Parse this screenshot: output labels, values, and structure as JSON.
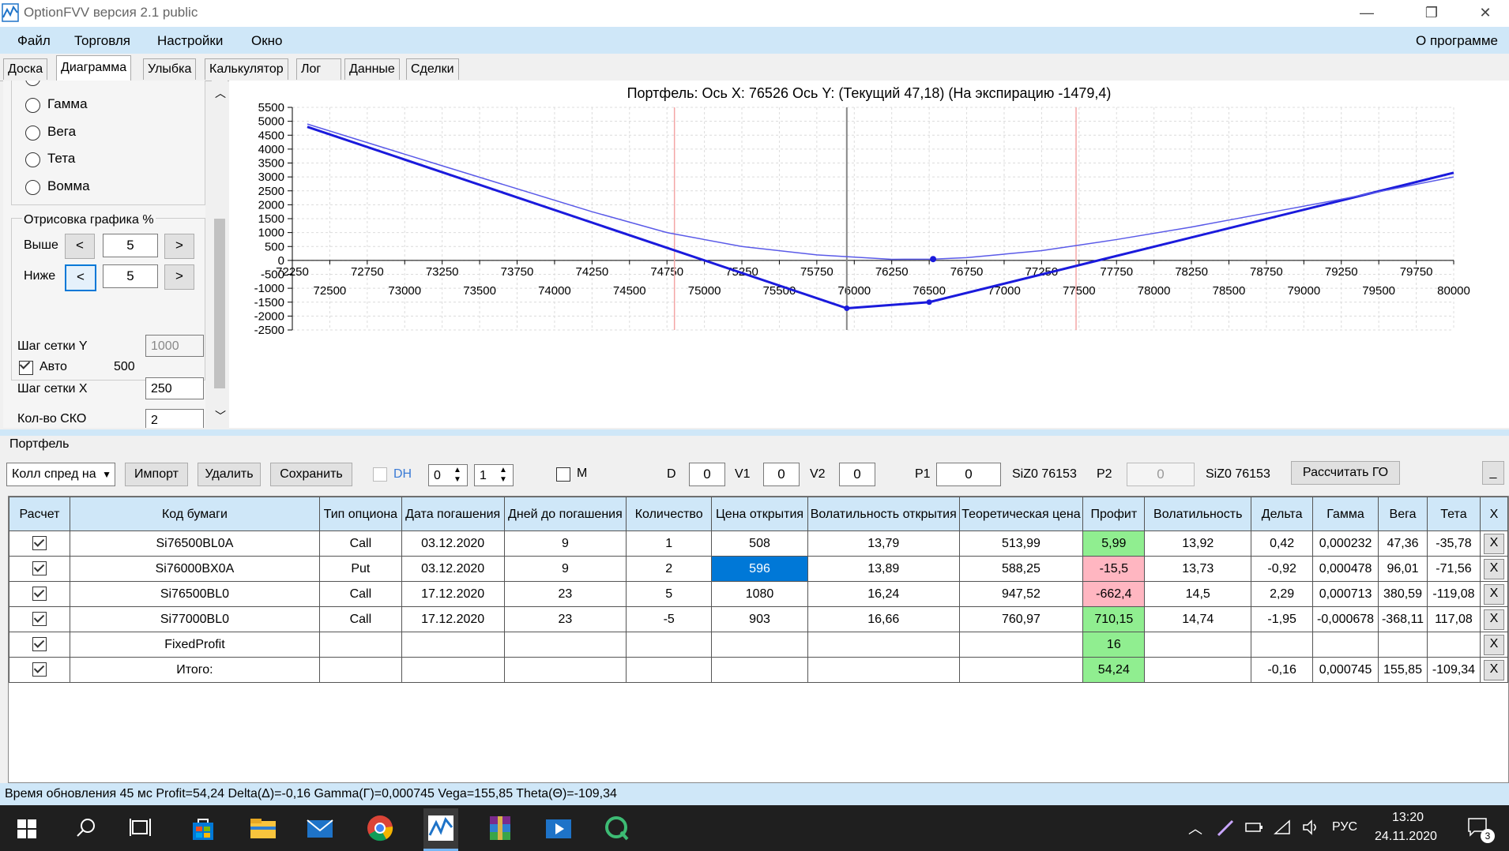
{
  "window": {
    "title": "OptionFVV версия 2.1 public",
    "controls": {
      "minimize": "—",
      "restore": "❐",
      "close": "✕"
    }
  },
  "menu": {
    "items": [
      "Файл",
      "Торговля",
      "Настройки",
      "Окно"
    ],
    "about": "О программе"
  },
  "tabs": [
    "Доска",
    "Диаграмма",
    "Улыбка",
    "Калькулятор",
    "Лог",
    "Данные",
    "Сделки"
  ],
  "active_tab": "Диаграмма",
  "left_panel": {
    "radios": [
      "Гамма",
      "Вега",
      "Тета",
      "Вомма"
    ],
    "render_group": {
      "title": "Отрисовка графика %",
      "above_label": "Выше",
      "above_value": "5",
      "below_label": "Ниже",
      "below_value": "5",
      "dec": "<",
      "inc": ">"
    },
    "grid_step_y_label": "Шаг сетки Y",
    "grid_step_y_value": "1000",
    "auto_label": "Авто",
    "auto_value": "500",
    "grid_step_x_label": "Шаг сетки X",
    "grid_step_x_value": "250",
    "sko_label": "Кол-во СКО",
    "sko_value": "2"
  },
  "chart_data": {
    "type": "line",
    "title": "Портфель:  Ось X:  76526 Ось Y:   (Текущий 47,18)   (На экспирацию  -1479,4)",
    "x_ticks_top": [
      72250,
      72750,
      73250,
      73750,
      74250,
      74750,
      75250,
      75750,
      76250,
      76750,
      77250,
      77750,
      78250,
      78750,
      79250,
      79750
    ],
    "x_ticks_bottom": [
      72500,
      73000,
      73500,
      74000,
      74500,
      75000,
      75500,
      76000,
      76500,
      77000,
      77500,
      78000,
      78500,
      79000,
      79500,
      80000
    ],
    "y_ticks": [
      5500,
      5000,
      4500,
      4000,
      3500,
      3000,
      2500,
      2000,
      1500,
      1000,
      500,
      0,
      -500,
      -1000,
      -1500,
      -2000,
      -2500
    ],
    "xlim": [
      72250,
      80000
    ],
    "ylim": [
      -2500,
      5500
    ],
    "grid": true,
    "vertical_markers": [
      {
        "x": 74800,
        "color": "#f4a6a6"
      },
      {
        "x": 75950,
        "color": "#888888"
      },
      {
        "x": 77480,
        "color": "#f4a6a6"
      }
    ],
    "series": [
      {
        "style": "expiration",
        "color": "#1a1adc",
        "width": 3,
        "x": [
          72350,
          75950,
          76500,
          80000
        ],
        "y": [
          4800,
          -1720,
          -1500,
          3150
        ]
      },
      {
        "style": "current",
        "color": "#5a5ae8",
        "width": 1.5,
        "x": [
          72350,
          73250,
          74250,
          74750,
          75250,
          75750,
          76250,
          76526,
          76750,
          77250,
          77750,
          78250,
          78750,
          79250,
          80000
        ],
        "y": [
          4900,
          3400,
          1750,
          1000,
          500,
          200,
          40,
          47,
          100,
          350,
          750,
          1200,
          1700,
          2200,
          3000
        ]
      }
    ],
    "point": {
      "x": 76526,
      "y": 47
    }
  },
  "portfolio": {
    "title": "Портфель",
    "strategy_select": "Колл спред на",
    "import_label": "Импорт",
    "delete_label": "Удалить",
    "save_label": "Сохранить",
    "dh_label": "DH",
    "spin1": "0",
    "spin2": "1",
    "m_label": "M",
    "d_label": "D",
    "d_value": "0",
    "v1_label": "V1",
    "v1_value": "0",
    "v2_label": "V2",
    "v2_value": "0",
    "p1_label": "P1",
    "p1_value": "0",
    "p1_instr": "SiZ0 76153",
    "p2_label": "P2",
    "p2_value": "0",
    "p2_instr": "SiZ0 76153",
    "calc_go_label": "Рассчитать ГО",
    "minimize_label": "_",
    "columns": [
      "Расчет",
      "Код бумаги",
      "Тип опциона",
      "Дата погашения",
      "Дней до погашения",
      "Количество",
      "Цена открытия",
      "Волатильность открытия",
      "Теоретическая цена",
      "Профит",
      "Волатильность",
      "Дельта",
      "Гамма",
      "Вега",
      "Тета",
      "X"
    ],
    "rows": [
      {
        "code": "Si76500BL0A",
        "type": "Call",
        "date": "03.12.2020",
        "days": "9",
        "qty": "1",
        "price": "508",
        "vol_open": "13,79",
        "theo": "513,99",
        "profit": "5,99",
        "profit_state": "g",
        "vol": "13,92",
        "delta": "0,42",
        "gamma": "0,000232",
        "vega": "47,36",
        "theta": "-35,78"
      },
      {
        "code": "Si76000BX0A",
        "type": "Put",
        "date": "03.12.2020",
        "days": "9",
        "qty": "2",
        "price": "596",
        "price_selected": true,
        "vol_open": "13,89",
        "theo": "588,25",
        "profit": "-15,5",
        "profit_state": "p",
        "vol": "13,73",
        "delta": "-0,92",
        "gamma": "0,000478",
        "vega": "96,01",
        "theta": "-71,56"
      },
      {
        "code": "Si76500BL0",
        "type": "Call",
        "date": "17.12.2020",
        "days": "23",
        "qty": "5",
        "price": "1080",
        "vol_open": "16,24",
        "theo": "947,52",
        "profit": "-662,4",
        "profit_state": "p",
        "vol": "14,5",
        "delta": "2,29",
        "gamma": "0,000713",
        "vega": "380,59",
        "theta": "-119,08"
      },
      {
        "code": "Si77000BL0",
        "type": "Call",
        "date": "17.12.2020",
        "days": "23",
        "qty": "-5",
        "price": "903",
        "vol_open": "16,66",
        "theo": "760,97",
        "profit": "710,15",
        "profit_state": "g",
        "vol": "14,74",
        "delta": "-1,95",
        "gamma": "-0,000678",
        "vega": "-368,11",
        "theta": "117,08"
      },
      {
        "code": "FixedProfit",
        "type": "",
        "date": "",
        "days": "",
        "qty": "",
        "price": "",
        "vol_open": "",
        "theo": "",
        "profit": "16",
        "profit_state": "g",
        "vol": "",
        "delta": "",
        "gamma": "",
        "vega": "",
        "theta": ""
      },
      {
        "code": "Итого:",
        "type": "",
        "date": "",
        "days": "",
        "qty": "",
        "price": "",
        "vol_open": "",
        "theo": "",
        "profit": "54,24",
        "profit_state": "g",
        "vol": "",
        "delta": "-0,16",
        "gamma": "0,000745",
        "vega": "155,85",
        "theta": "-109,34"
      }
    ],
    "remove_glyph": "X"
  },
  "status": {
    "text": "Время обновления 45 мс  Profit=54,24 Delta(Δ)=-0,16 Gamma(Γ)=0,000745 Vega=155,85 Theta(Θ)=-109,34"
  },
  "taskbar": {
    "language": "РУС",
    "time": "13:20",
    "date": "24.11.2020",
    "notifications": "3"
  }
}
